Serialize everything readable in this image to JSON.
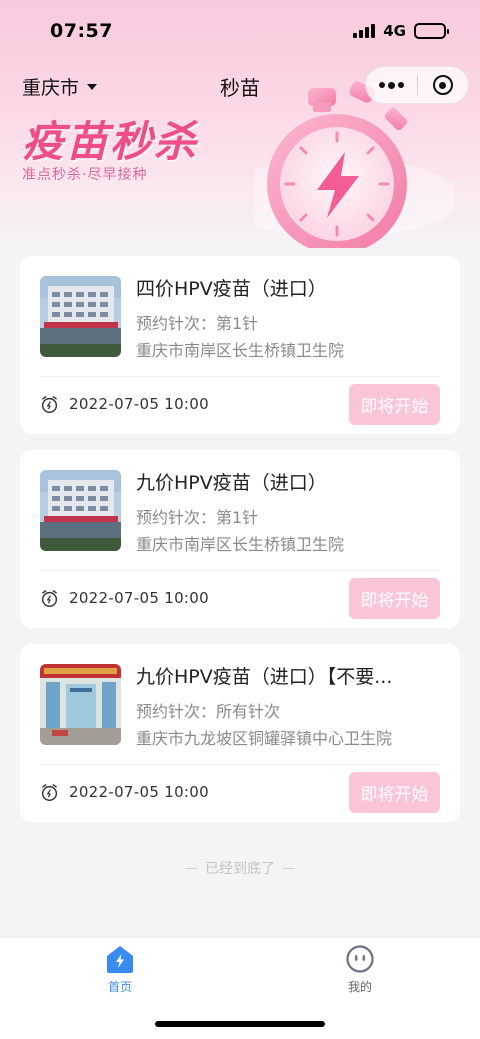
{
  "status_bar": {
    "time": "07:57",
    "network": "4G"
  },
  "nav": {
    "city": "重庆市",
    "title": "秒苗"
  },
  "hero": {
    "title": "疫苗秒杀",
    "subtitle": "准点秒杀·尽早接种"
  },
  "cards": [
    {
      "title": "四价HPV疫苗（进口）",
      "dose": "预约针次：第1针",
      "hospital": "重庆市南岸区长生桥镇卫生院",
      "time": "2022-07-05 10:00",
      "button": "即将开始"
    },
    {
      "title": "九价HPV疫苗（进口）",
      "dose": "预约针次：第1针",
      "hospital": "重庆市南岸区长生桥镇卫生院",
      "time": "2022-07-05 10:00",
      "button": "即将开始"
    },
    {
      "title": "九价HPV疫苗（进口）【不要...",
      "dose": "预约针次：所有针次",
      "hospital": "重庆市九龙坡区铜罐驿镇中心卫生院",
      "time": "2022-07-05 10:00",
      "button": "即将开始"
    }
  ],
  "end_note": "已经到底了",
  "tabbar": {
    "home": "首页",
    "mine": "我的"
  },
  "icons": {
    "city_caret": "caret-down-icon",
    "menu": "more-dots-icon",
    "close": "target-circle-icon",
    "stopwatch": "stopwatch-lightning-icon",
    "clock": "alarm-clock-icon",
    "home": "home-lightning-icon",
    "mine": "smiley-face-icon"
  },
  "colors": {
    "accent_pink": "#ee4d86",
    "button_pink": "#fbc5d8",
    "tab_active": "#3a8bf0"
  }
}
